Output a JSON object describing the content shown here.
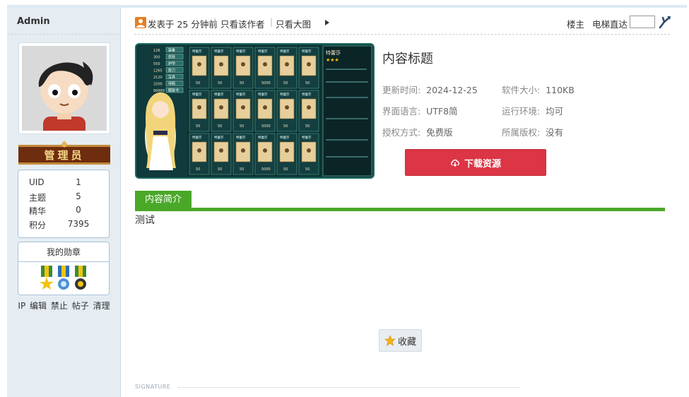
{
  "author": {
    "name": "Admin"
  },
  "user_group": {
    "label": "管理员"
  },
  "stats": [
    {
      "key": "UID",
      "value": "1"
    },
    {
      "key": "主题",
      "value": "5"
    },
    {
      "key": "精华",
      "value": "0"
    },
    {
      "key": "积分",
      "value": "7395"
    }
  ],
  "medals": {
    "title": "我的勋章"
  },
  "admin_links": [
    "IP",
    "编辑",
    "禁止",
    "帖子",
    "清理"
  ],
  "postbar": {
    "post_time": "发表于 25 分钟前",
    "only_author": "只看该作者",
    "only_image": "只看大图",
    "floor_master": "楼主",
    "elevator": "电梯直达"
  },
  "resource": {
    "title": "内容标题",
    "update_label": "更新时间:",
    "update_value": "2024-12-25",
    "size_label": "软件大小:",
    "size_value": "110KB",
    "lang_label": "界面语言:",
    "lang_value": "UTF8简",
    "env_label": "运行环境:",
    "env_value": "均可",
    "license_label": "授权方式:",
    "license_value": "免费版",
    "copyright_label": "所属版权:",
    "copyright_value": "没有",
    "download_label": "下载资源"
  },
  "intro": {
    "tab_label": "内容简介",
    "text": "测试"
  },
  "favorite": {
    "label": "收藏"
  },
  "signature": {
    "label": "SIGNATURE"
  },
  "colors": {
    "accent_green": "#4aa829",
    "download_red": "#dc3545",
    "sidebar_bg": "#e5edf2"
  },
  "game_image": {
    "hero_name": "特蕾莎",
    "left_values": [
      "126",
      "300",
      "550",
      "1265",
      "2120",
      "3200",
      "99999"
    ],
    "left_tags": [
      "装备",
      "皮肤",
      "护甲",
      "能力",
      "宝具",
      "师羁",
      "图鉴书"
    ],
    "card_label": "特蕾莎",
    "card_costs": [
      "50",
      "50",
      "50",
      "5000",
      "50",
      "50"
    ]
  }
}
